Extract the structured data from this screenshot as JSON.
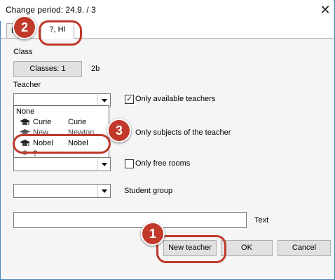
{
  "window": {
    "title": "Change period: 24.9. / 3",
    "close_glyph": "✕"
  },
  "tabs": [
    {
      "label": "Hi"
    },
    {
      "label": "?, HI"
    }
  ],
  "class_section": {
    "label": "Class",
    "button_label": "Classes: 1",
    "value": "2b"
  },
  "teacher_section": {
    "label": "Teacher",
    "options": [
      {
        "short": "None",
        "name": ""
      },
      {
        "short": "Curie",
        "name": "Curie"
      },
      {
        "short": "New",
        "name": "Newton"
      },
      {
        "short": "Nobel",
        "name": "Nobel"
      },
      {
        "short": "?",
        "name": ""
      }
    ]
  },
  "checkboxes": {
    "only_available_teachers": {
      "label": "Only available teachers",
      "checked": true
    },
    "only_subjects_of_teacher": {
      "label": "Only subjects of the teacher",
      "checked": false
    },
    "only_free_rooms": {
      "label": "Only free rooms",
      "checked": false
    }
  },
  "student_group": {
    "label": "Student group"
  },
  "text_field": {
    "label": "Text",
    "value": ""
  },
  "buttons": {
    "new_teacher": "New teacher",
    "ok": "OK",
    "cancel": "Cancel"
  },
  "badges": [
    "1",
    "2",
    "3"
  ],
  "colors": {
    "badge": "#c0392b",
    "accent_border": "#4a7eb5"
  },
  "icons": {
    "teacher_option": "mortarboard-icon"
  }
}
